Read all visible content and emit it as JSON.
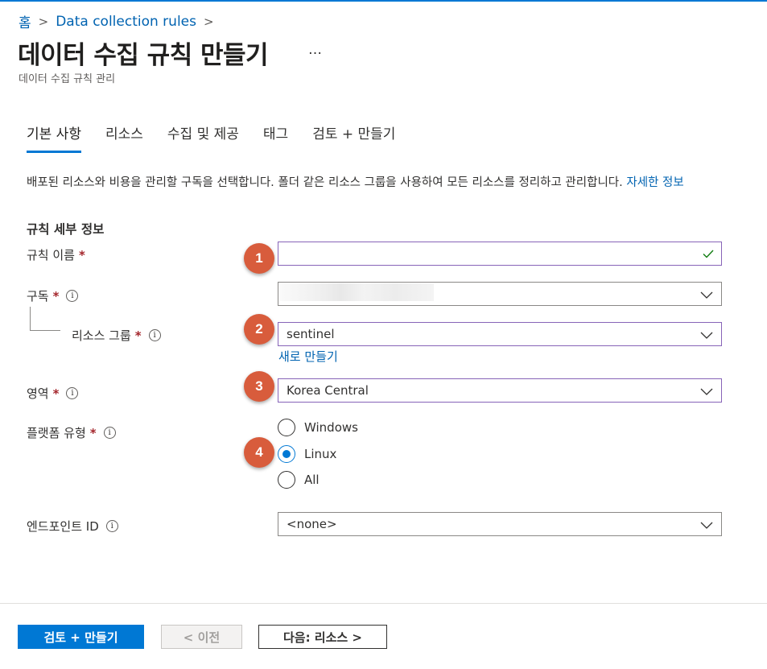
{
  "breadcrumb": {
    "home": "홈",
    "item": "Data collection rules",
    "separator": ">"
  },
  "header": {
    "title": "데이터 수집 규칙 만들기",
    "more": "…",
    "subtitle": "데이터 수집 규칙 관리"
  },
  "tabs": [
    {
      "label": "기본 사항",
      "active": true
    },
    {
      "label": "리소스",
      "active": false
    },
    {
      "label": "수집 및 제공",
      "active": false
    },
    {
      "label": "태그",
      "active": false
    },
    {
      "label": "검토 + 만들기",
      "active": false
    }
  ],
  "description": {
    "text": "배포된 리소스와 비용을 관리할 구독을 선택합니다. 폴더 같은 리소스 그룹을 사용하여 모든 리소스를 정리하고 관리합니다. ",
    "link": "자세한 정보"
  },
  "section": {
    "title": "규칙 세부 정보"
  },
  "form": {
    "required_mark": "*",
    "info_icon": "i",
    "rule_name": {
      "label": "규칙 이름",
      "value": ""
    },
    "subscription": {
      "label": "구독",
      "value": ""
    },
    "resource_group": {
      "label": "리소스 그룹",
      "value": "sentinel",
      "create_new": "새로 만들기"
    },
    "region": {
      "label": "영역",
      "value": "Korea Central"
    },
    "platform": {
      "label": "플랫폼 유형",
      "options": [
        {
          "label": "Windows",
          "selected": false
        },
        {
          "label": "Linux",
          "selected": true
        },
        {
          "label": "All",
          "selected": false
        }
      ]
    },
    "endpoint": {
      "label": "엔드포인트 ID",
      "value": "<none>"
    }
  },
  "annotations": [
    "1",
    "2",
    "3",
    "4"
  ],
  "footer": {
    "review_create": "검토 + 만들기",
    "previous": "< 이전",
    "next": "다음: 리소스 >"
  },
  "colors": {
    "accent": "#0078d4",
    "badge": "#d85c3c",
    "active_border": "#8764b8",
    "check": "#107c10"
  }
}
